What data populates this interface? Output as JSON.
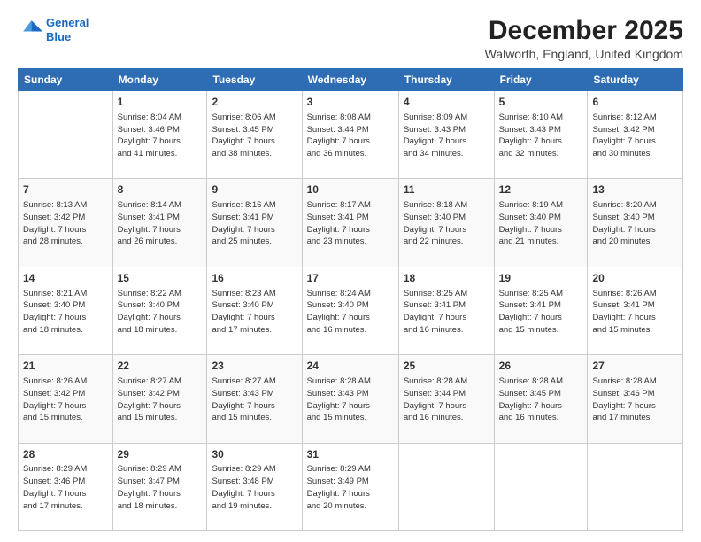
{
  "logo": {
    "line1": "General",
    "line2": "Blue"
  },
  "header": {
    "title": "December 2025",
    "subtitle": "Walworth, England, United Kingdom"
  },
  "weekdays": [
    "Sunday",
    "Monday",
    "Tuesday",
    "Wednesday",
    "Thursday",
    "Friday",
    "Saturday"
  ],
  "weeks": [
    [
      {
        "day": "",
        "info": ""
      },
      {
        "day": "1",
        "info": "Sunrise: 8:04 AM\nSunset: 3:46 PM\nDaylight: 7 hours\nand 41 minutes."
      },
      {
        "day": "2",
        "info": "Sunrise: 8:06 AM\nSunset: 3:45 PM\nDaylight: 7 hours\nand 38 minutes."
      },
      {
        "day": "3",
        "info": "Sunrise: 8:08 AM\nSunset: 3:44 PM\nDaylight: 7 hours\nand 36 minutes."
      },
      {
        "day": "4",
        "info": "Sunrise: 8:09 AM\nSunset: 3:43 PM\nDaylight: 7 hours\nand 34 minutes."
      },
      {
        "day": "5",
        "info": "Sunrise: 8:10 AM\nSunset: 3:43 PM\nDaylight: 7 hours\nand 32 minutes."
      },
      {
        "day": "6",
        "info": "Sunrise: 8:12 AM\nSunset: 3:42 PM\nDaylight: 7 hours\nand 30 minutes."
      }
    ],
    [
      {
        "day": "7",
        "info": "Sunrise: 8:13 AM\nSunset: 3:42 PM\nDaylight: 7 hours\nand 28 minutes."
      },
      {
        "day": "8",
        "info": "Sunrise: 8:14 AM\nSunset: 3:41 PM\nDaylight: 7 hours\nand 26 minutes."
      },
      {
        "day": "9",
        "info": "Sunrise: 8:16 AM\nSunset: 3:41 PM\nDaylight: 7 hours\nand 25 minutes."
      },
      {
        "day": "10",
        "info": "Sunrise: 8:17 AM\nSunset: 3:41 PM\nDaylight: 7 hours\nand 23 minutes."
      },
      {
        "day": "11",
        "info": "Sunrise: 8:18 AM\nSunset: 3:40 PM\nDaylight: 7 hours\nand 22 minutes."
      },
      {
        "day": "12",
        "info": "Sunrise: 8:19 AM\nSunset: 3:40 PM\nDaylight: 7 hours\nand 21 minutes."
      },
      {
        "day": "13",
        "info": "Sunrise: 8:20 AM\nSunset: 3:40 PM\nDaylight: 7 hours\nand 20 minutes."
      }
    ],
    [
      {
        "day": "14",
        "info": "Sunrise: 8:21 AM\nSunset: 3:40 PM\nDaylight: 7 hours\nand 18 minutes."
      },
      {
        "day": "15",
        "info": "Sunrise: 8:22 AM\nSunset: 3:40 PM\nDaylight: 7 hours\nand 18 minutes."
      },
      {
        "day": "16",
        "info": "Sunrise: 8:23 AM\nSunset: 3:40 PM\nDaylight: 7 hours\nand 17 minutes."
      },
      {
        "day": "17",
        "info": "Sunrise: 8:24 AM\nSunset: 3:40 PM\nDaylight: 7 hours\nand 16 minutes."
      },
      {
        "day": "18",
        "info": "Sunrise: 8:25 AM\nSunset: 3:41 PM\nDaylight: 7 hours\nand 16 minutes."
      },
      {
        "day": "19",
        "info": "Sunrise: 8:25 AM\nSunset: 3:41 PM\nDaylight: 7 hours\nand 15 minutes."
      },
      {
        "day": "20",
        "info": "Sunrise: 8:26 AM\nSunset: 3:41 PM\nDaylight: 7 hours\nand 15 minutes."
      }
    ],
    [
      {
        "day": "21",
        "info": "Sunrise: 8:26 AM\nSunset: 3:42 PM\nDaylight: 7 hours\nand 15 minutes."
      },
      {
        "day": "22",
        "info": "Sunrise: 8:27 AM\nSunset: 3:42 PM\nDaylight: 7 hours\nand 15 minutes."
      },
      {
        "day": "23",
        "info": "Sunrise: 8:27 AM\nSunset: 3:43 PM\nDaylight: 7 hours\nand 15 minutes."
      },
      {
        "day": "24",
        "info": "Sunrise: 8:28 AM\nSunset: 3:43 PM\nDaylight: 7 hours\nand 15 minutes."
      },
      {
        "day": "25",
        "info": "Sunrise: 8:28 AM\nSunset: 3:44 PM\nDaylight: 7 hours\nand 16 minutes."
      },
      {
        "day": "26",
        "info": "Sunrise: 8:28 AM\nSunset: 3:45 PM\nDaylight: 7 hours\nand 16 minutes."
      },
      {
        "day": "27",
        "info": "Sunrise: 8:28 AM\nSunset: 3:46 PM\nDaylight: 7 hours\nand 17 minutes."
      }
    ],
    [
      {
        "day": "28",
        "info": "Sunrise: 8:29 AM\nSunset: 3:46 PM\nDaylight: 7 hours\nand 17 minutes."
      },
      {
        "day": "29",
        "info": "Sunrise: 8:29 AM\nSunset: 3:47 PM\nDaylight: 7 hours\nand 18 minutes."
      },
      {
        "day": "30",
        "info": "Sunrise: 8:29 AM\nSunset: 3:48 PM\nDaylight: 7 hours\nand 19 minutes."
      },
      {
        "day": "31",
        "info": "Sunrise: 8:29 AM\nSunset: 3:49 PM\nDaylight: 7 hours\nand 20 minutes."
      },
      {
        "day": "",
        "info": ""
      },
      {
        "day": "",
        "info": ""
      },
      {
        "day": "",
        "info": ""
      }
    ]
  ]
}
